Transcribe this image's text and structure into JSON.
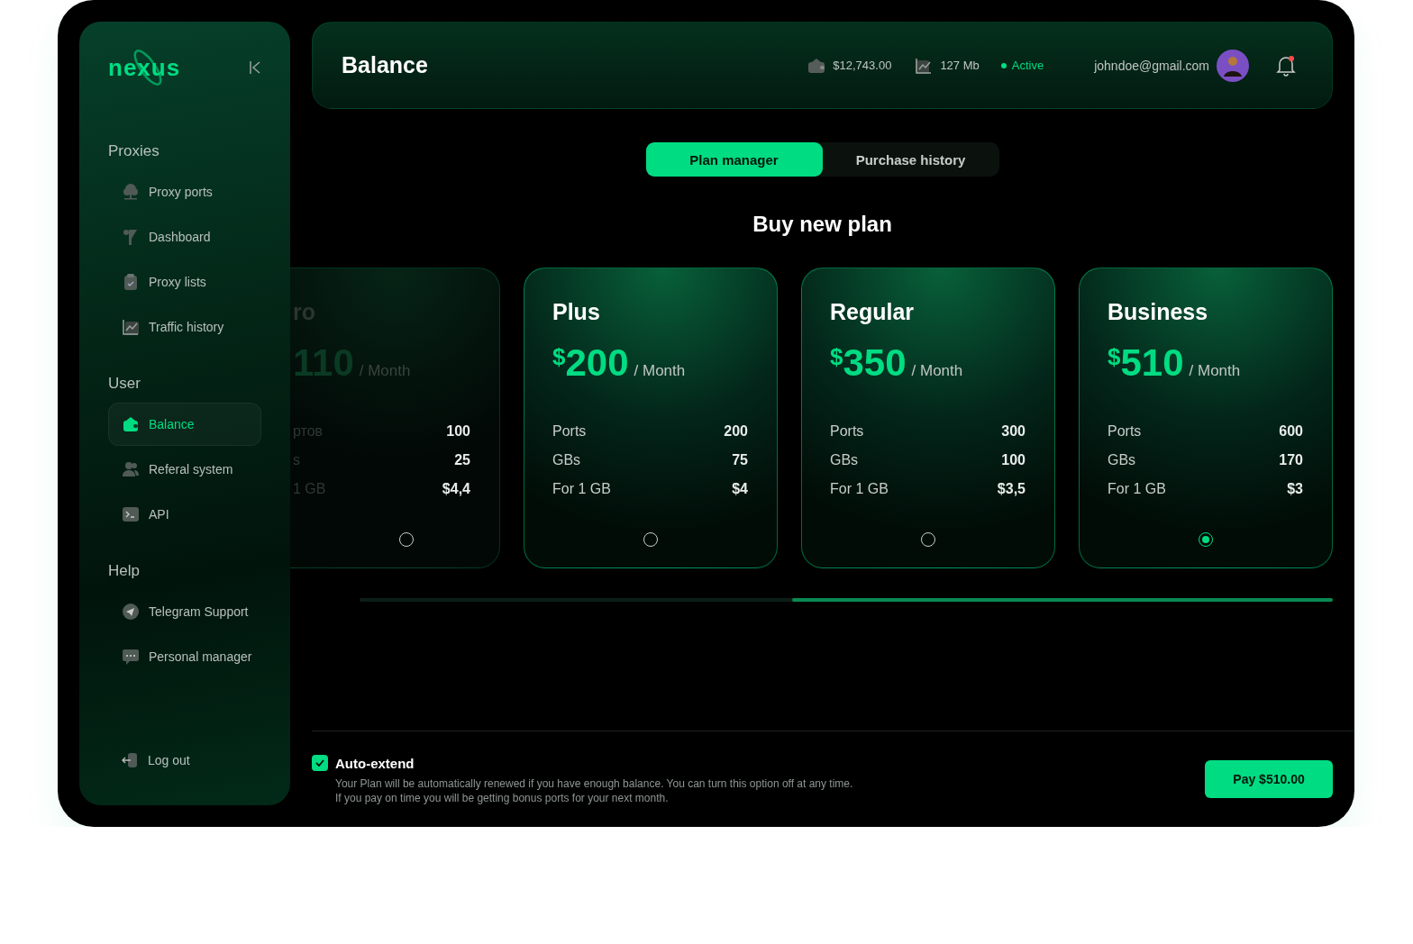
{
  "sidebar": {
    "logo": "nexus",
    "sections": [
      {
        "title": "Proxies",
        "items": [
          {
            "label": "Proxy ports",
            "selected": false
          },
          {
            "label": "Dashboard",
            "selected": false
          },
          {
            "label": "Proxy lists",
            "selected": false
          },
          {
            "label": "Traffic history",
            "selected": false
          }
        ]
      },
      {
        "title": "User",
        "items": [
          {
            "label": "Balance",
            "selected": true
          },
          {
            "label": "Referal system",
            "selected": false
          },
          {
            "label": "API",
            "selected": false
          }
        ]
      },
      {
        "title": "Help",
        "items": [
          {
            "label": "Telegram Support",
            "selected": false
          },
          {
            "label": "Personal manager",
            "selected": false
          }
        ]
      }
    ],
    "logout": "Log out"
  },
  "header": {
    "title": "Balance",
    "balance": "$12,743.00",
    "traffic": "127 Mb",
    "status": "Active",
    "email": "johndoe@gmail.com",
    "notification": true
  },
  "tabs": [
    {
      "label": "Plan manager",
      "selected": true
    },
    {
      "label": "Purchase history",
      "selected": false
    }
  ],
  "heading": "Buy new plan",
  "plans": [
    {
      "kind": "partial",
      "title": "ro",
      "price": "110",
      "period": "/ Month",
      "rows": [
        {
          "label": "ртов",
          "value": "100"
        },
        {
          "label": "s",
          "value": "25"
        },
        {
          "label": "1 GB",
          "value": "$4,4"
        }
      ],
      "selected": false
    },
    {
      "kind": "full",
      "title": "Plus",
      "currency": "$",
      "price": "200",
      "period": "/ Month",
      "rows": [
        {
          "label": "Ports",
          "value": "200"
        },
        {
          "label": "GBs",
          "value": "75"
        },
        {
          "label": "For 1 GB",
          "value": "$4"
        }
      ],
      "selected": false
    },
    {
      "kind": "full",
      "title": "Regular",
      "currency": "$",
      "price": "350",
      "period": "/ Month",
      "rows": [
        {
          "label": "Ports",
          "value": "300"
        },
        {
          "label": "GBs",
          "value": "100"
        },
        {
          "label": "For 1 GB",
          "value": "$3,5"
        }
      ],
      "selected": false
    },
    {
      "kind": "full",
      "title": "Business",
      "currency": "$",
      "price": "510",
      "period": "/ Month",
      "rows": [
        {
          "label": "Ports",
          "value": "600"
        },
        {
          "label": "GBs",
          "value": "170"
        },
        {
          "label": "For 1 GB",
          "value": "$3"
        }
      ],
      "selected": true
    }
  ],
  "footer": {
    "auto_extend": {
      "label": "Auto-extend",
      "checked": true,
      "description": "Your Plan will be automatically renewed if you have enough balance. You can turn this option off at any time. If you pay on time you will be getting bonus ports for your next month."
    },
    "pay_button": "Pay $510.00"
  }
}
